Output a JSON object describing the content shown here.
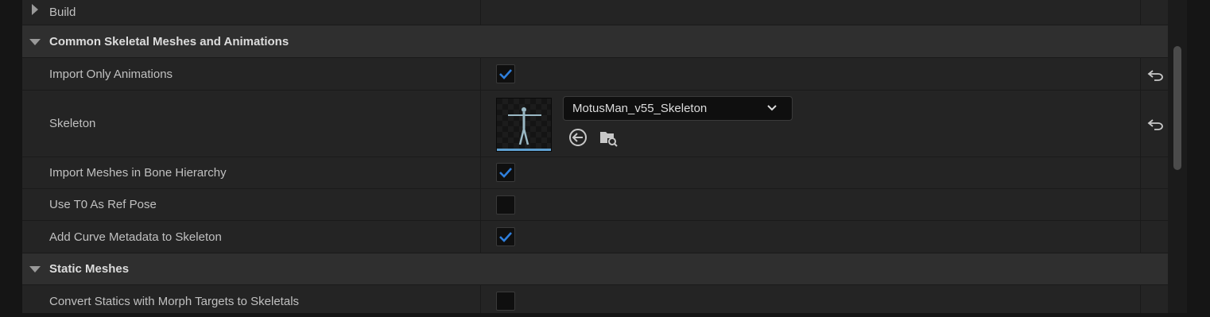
{
  "rows": {
    "build": {
      "label": "Build"
    },
    "common_category": {
      "label": "Common Skeletal Meshes and Animations"
    },
    "import_only_animations": {
      "label": "Import Only Animations",
      "checked": true
    },
    "skeleton": {
      "label": "Skeleton",
      "value": "MotusMan_v55_Skeleton"
    },
    "import_meshes_bone_hierarchy": {
      "label": "Import Meshes in Bone Hierarchy",
      "checked": true
    },
    "use_t0_ref_pose": {
      "label": "Use T0 As Ref Pose",
      "checked": false
    },
    "add_curve_metadata": {
      "label": "Add Curve Metadata to Skeleton",
      "checked": true
    },
    "static_category": {
      "label": "Static Meshes"
    },
    "convert_statics_morph": {
      "label": "Convert Statics with Morph Targets to Skeletals",
      "checked": false
    }
  },
  "colors": {
    "accent": "#2f7fdc",
    "panel": "#242424",
    "category": "#2f2f2f"
  }
}
